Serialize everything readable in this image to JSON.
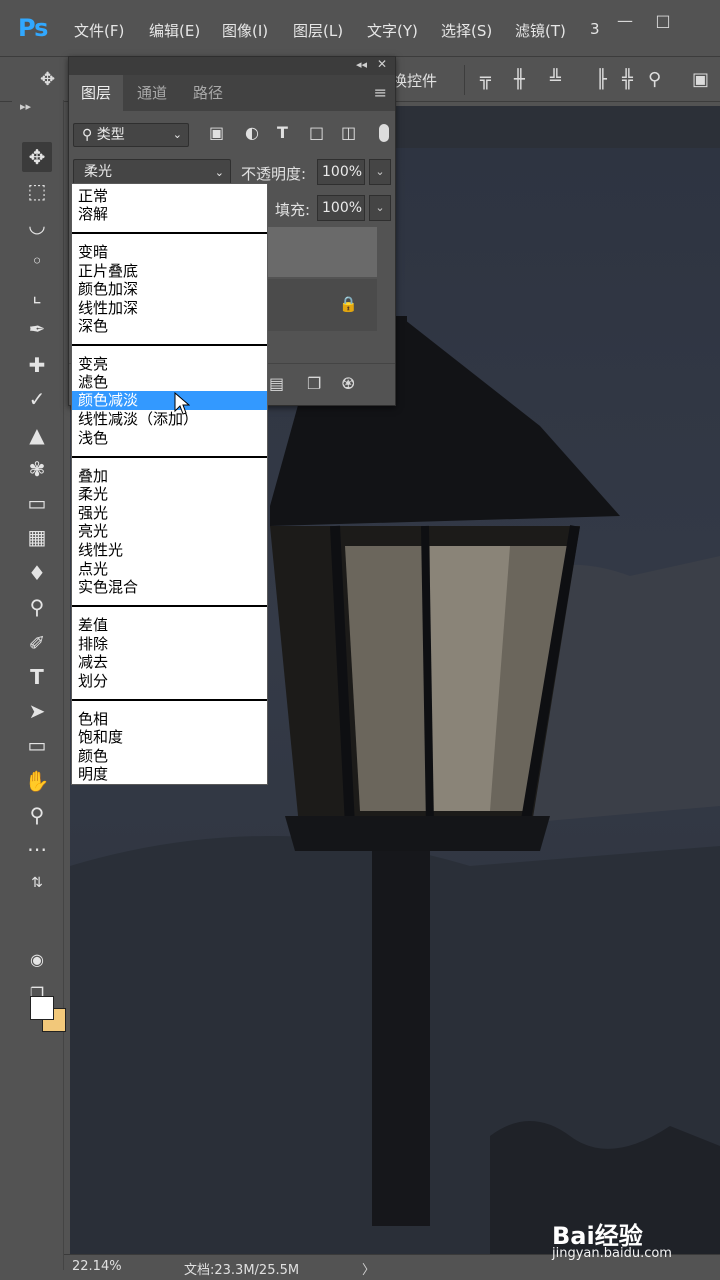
{
  "app": {
    "logo": "Ps"
  },
  "menubar": {
    "items": [
      "文件(F)",
      "编辑(E)",
      "图像(I)",
      "图层(L)",
      "文字(Y)",
      "选择(S)",
      "滤镜(T)",
      "3"
    ],
    "window_controls": [
      "minimize",
      "maximize"
    ]
  },
  "optionsbar": {
    "transform_label": "换控件",
    "icons": [
      "move-icon",
      "align-top-icon",
      "align-vcenter-icon",
      "align-bottom-icon",
      "align-left-icon",
      "search-icon",
      "screen-mode-icon"
    ]
  },
  "toolbar": {
    "tools": [
      "move-tool-icon",
      "marquee-tool-icon",
      "lasso-tool-icon",
      "quick-select-tool-icon",
      "crop-tool-icon",
      "eyedropper-tool-icon",
      "healing-brush-tool-icon",
      "brush-tool-icon",
      "clone-stamp-tool-icon",
      "history-brush-tool-icon",
      "eraser-tool-icon",
      "gradient-tool-icon",
      "blur-tool-icon",
      "dodge-tool-icon",
      "pen-tool-icon",
      "type-tool-icon",
      "path-select-tool-icon",
      "rectangle-tool-icon",
      "hand-tool-icon",
      "zoom-tool-icon",
      "more-tools-icon"
    ],
    "foreground_color": "#ffffff",
    "background_color": "#f2c87a"
  },
  "layers_panel": {
    "tabs": [
      "图层",
      "通道",
      "路径"
    ],
    "active_tab": "图层",
    "filter_kind": "类型",
    "blend_mode": "柔光",
    "opacity_label": "不透明度:",
    "opacity_value": "100%",
    "fill_label": "填充:",
    "fill_value": "100%"
  },
  "blend_dropdown": {
    "groups": [
      [
        "正常",
        "溶解"
      ],
      [
        "变暗",
        "正片叠底",
        "颜色加深",
        "线性加深",
        "深色"
      ],
      [
        "变亮",
        "滤色",
        "颜色减淡",
        "线性减淡（添加）",
        "浅色"
      ],
      [
        "叠加",
        "柔光",
        "强光",
        "亮光",
        "线性光",
        "点光",
        "实色混合"
      ],
      [
        "差值",
        "排除",
        "减去",
        "划分"
      ],
      [
        "色相",
        "饱和度",
        "颜色",
        "明度"
      ]
    ],
    "highlighted": "颜色减淡"
  },
  "statusbar": {
    "zoom": "22.14%",
    "doc_info": "文档:23.3M/25.5M",
    "arrow": "〉"
  },
  "watermark": {
    "brand": "Bai经验",
    "url": "jingyan.baidu.com"
  },
  "colors": {
    "chrome": "#535353",
    "selection": "#3399ff",
    "ps_blue": "#31a8ff"
  }
}
